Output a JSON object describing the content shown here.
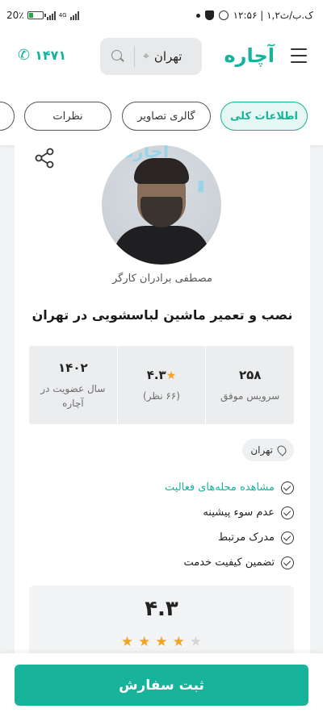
{
  "status_bar": {
    "time": "۱۲:۵۶ | ۱,۲ک.ب/ث",
    "battery_percent": "20٪",
    "network": "4G"
  },
  "header": {
    "logo": "آچاره",
    "search_city": "تهران",
    "phone": "۱۴۷۱"
  },
  "tabs": [
    {
      "label": "اطلاعات کلی",
      "active": true
    },
    {
      "label": "گالری تصاویر",
      "active": false
    },
    {
      "label": "نظرات",
      "active": false
    }
  ],
  "provider": {
    "name": "مصطفی برادران کارگر",
    "avatar_bg_text": "آچاره"
  },
  "service": {
    "title": "نصب و تعمیر ماشین لباسشویی در تهران"
  },
  "stats": {
    "successful_services": {
      "value": "۲۵۸",
      "label": "سرویس موفق"
    },
    "rating": {
      "value": "۴.۳",
      "reviews": "(۶۶ نظر)"
    },
    "membership": {
      "value": "۱۴۰۲",
      "label": "سال عضویت در آچاره"
    }
  },
  "city": "تهران",
  "features": [
    {
      "label": "مشاهده محله‌های فعالیت",
      "link": true
    },
    {
      "label": "عدم سوء پیشینه",
      "link": false
    },
    {
      "label": "مدرک مرتبط",
      "link": false
    },
    {
      "label": "تضمین کیفیت خدمت",
      "link": false
    }
  ],
  "rating_box": {
    "score": "۴.۳",
    "stars_filled": 4,
    "stars_total": 5
  },
  "order_button": "ثبت سفارش",
  "colors": {
    "brand": "#17b39a",
    "star": "#f3a320"
  }
}
